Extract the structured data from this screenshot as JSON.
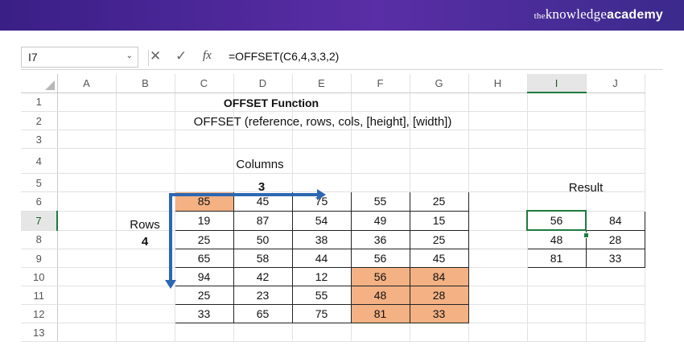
{
  "brand": {
    "small": "the",
    "light": "knowledge",
    "bold": "academy"
  },
  "formula_bar": {
    "name_box": "I7",
    "name_box_arrow": "⌄",
    "cancel_icon": "✕",
    "enter_icon": "✓",
    "fx_label": "fx",
    "formula": "=OFFSET(C6,4,3,3,2)"
  },
  "columns": [
    "A",
    "B",
    "C",
    "D",
    "E",
    "F",
    "G",
    "H",
    "I",
    "J"
  ],
  "rows": [
    "1",
    "2",
    "3",
    "4",
    "5",
    "6",
    "7",
    "8",
    "9",
    "10",
    "11",
    "12",
    "13"
  ],
  "sheet": {
    "title": "OFFSET Function",
    "syntax": "OFFSET (reference, rows, cols, [height], [width])",
    "columns_label": "Columns",
    "cols_value": "3",
    "rows_label": "Rows",
    "rows_value": "4",
    "result_label": "Result"
  },
  "table": [
    [
      "85",
      "45",
      "75",
      "55",
      "25"
    ],
    [
      "19",
      "87",
      "54",
      "49",
      "15"
    ],
    [
      "25",
      "50",
      "38",
      "36",
      "25"
    ],
    [
      "65",
      "58",
      "44",
      "56",
      "45"
    ],
    [
      "94",
      "42",
      "12",
      "56",
      "84"
    ],
    [
      "25",
      "23",
      "55",
      "48",
      "28"
    ],
    [
      "33",
      "65",
      "75",
      "81",
      "33"
    ]
  ],
  "result": [
    [
      "56",
      "84"
    ],
    [
      "48",
      "28"
    ],
    [
      "81",
      "33"
    ]
  ],
  "colors": {
    "highlight": "#f4b184",
    "arrow": "#2d67b2",
    "selection": "#1f7a3e",
    "banner": "#4a2899"
  }
}
